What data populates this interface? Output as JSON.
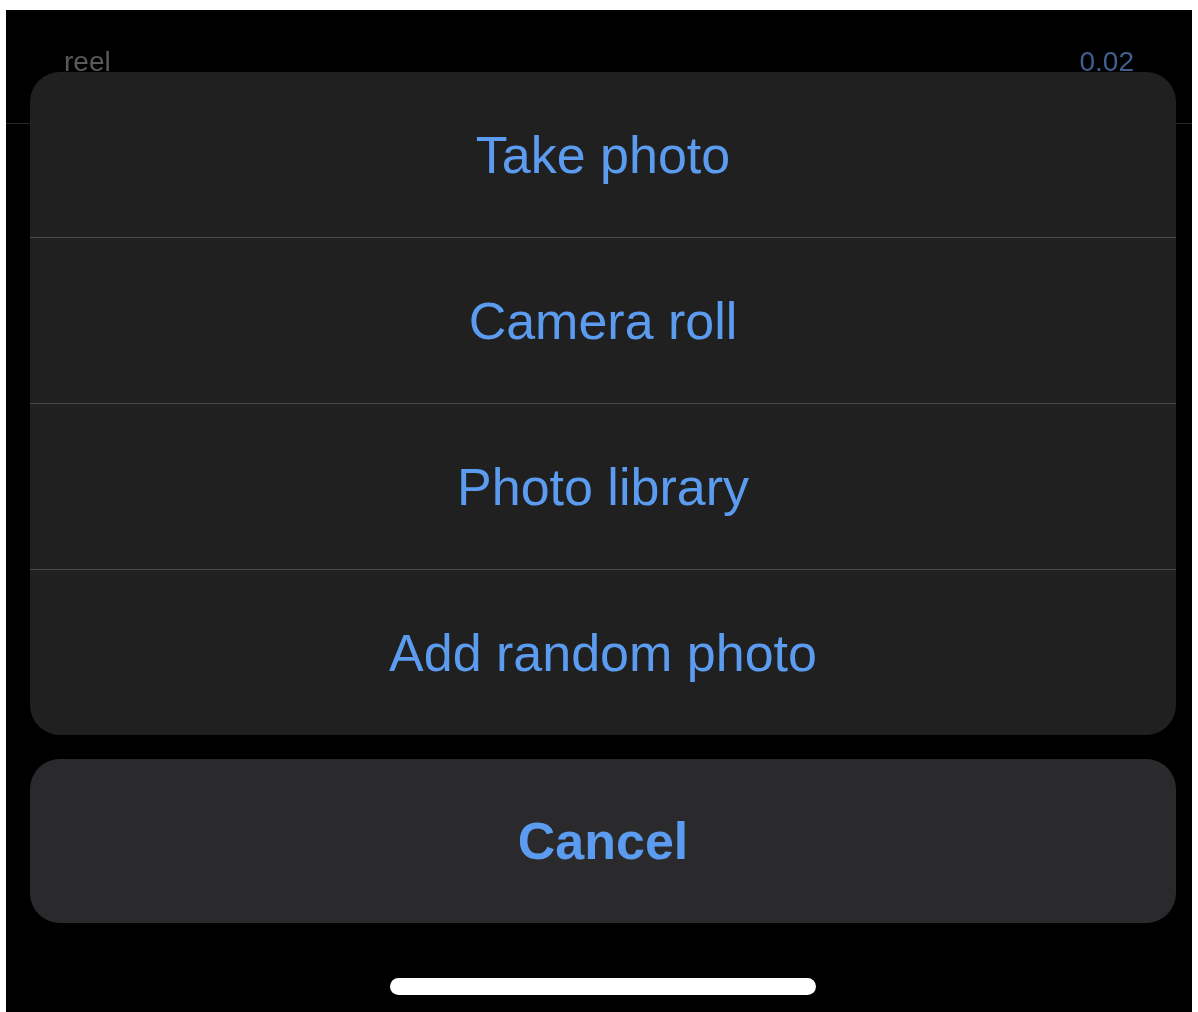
{
  "background_row": {
    "label": "reel",
    "value": "0.02"
  },
  "action_sheet": {
    "actions": [
      {
        "label": "Take photo"
      },
      {
        "label": "Camera roll"
      },
      {
        "label": "Photo library"
      },
      {
        "label": "Add random photo"
      }
    ],
    "cancel": {
      "label": "Cancel"
    }
  }
}
